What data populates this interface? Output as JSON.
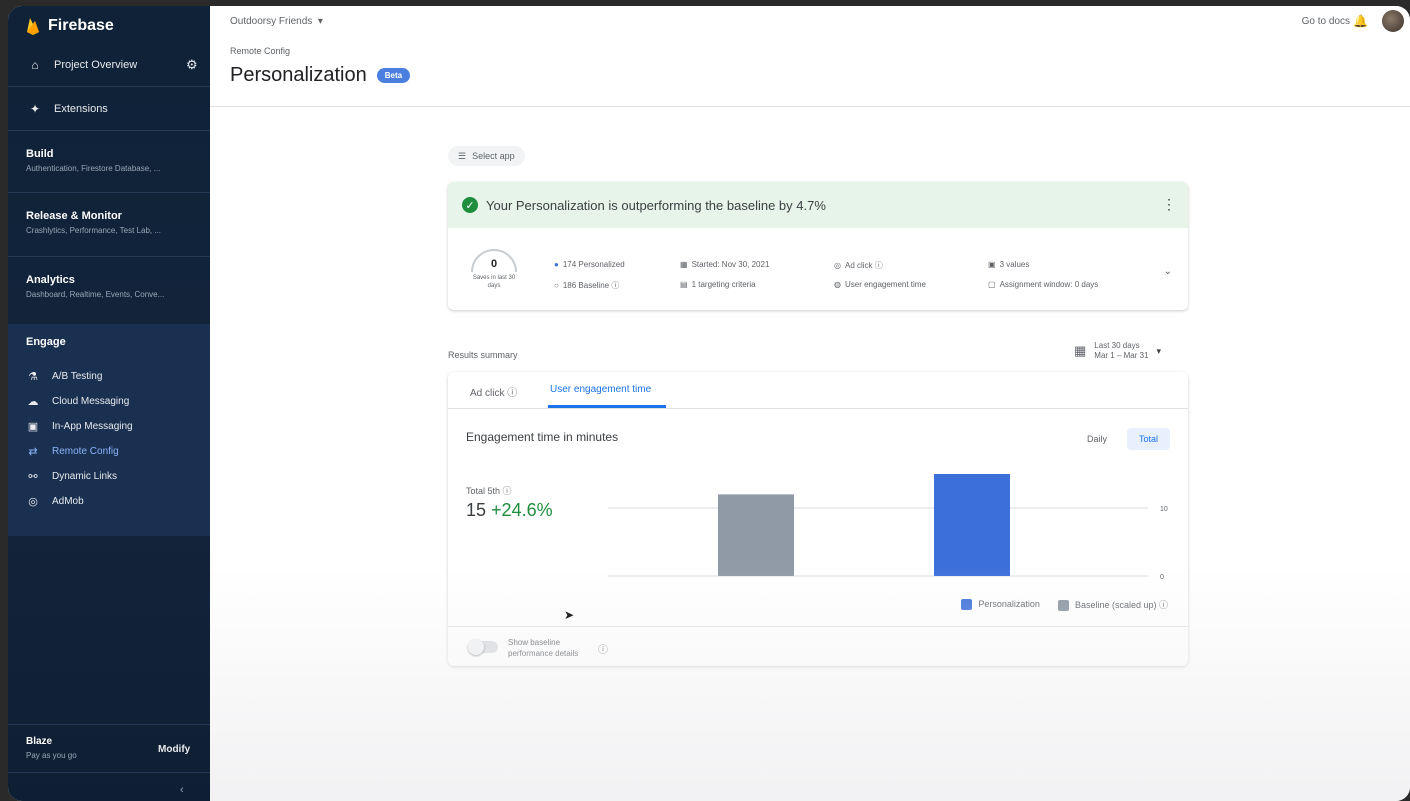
{
  "app": {
    "brand": "Firebase"
  },
  "sidebar": {
    "project_overview": "Project Overview",
    "extensions": "Extensions",
    "sections": [
      {
        "title": "Build",
        "subtitle": "Authentication, Firestore Database, ..."
      },
      {
        "title": "Release & Monitor",
        "subtitle": "Crashlytics, Performance, Test Lab, ..."
      },
      {
        "title": "Analytics",
        "subtitle": "Dashboard, Realtime, Events, Conve..."
      }
    ],
    "engage": {
      "title": "Engage",
      "items": [
        {
          "label": "A/B Testing",
          "icon": "flask-icon"
        },
        {
          "label": "Cloud Messaging",
          "icon": "cloud-messaging-icon"
        },
        {
          "label": "In-App Messaging",
          "icon": "in-app-messaging-icon"
        },
        {
          "label": "Remote Config",
          "icon": "remote-config-icon"
        },
        {
          "label": "Dynamic Links",
          "icon": "link-icon"
        },
        {
          "label": "AdMob",
          "icon": "admob-icon"
        }
      ],
      "active_index": 3
    },
    "plan": {
      "name": "Blaze",
      "sub": "Pay as you go",
      "modify": "Modify"
    }
  },
  "header": {
    "project": "Outdoorsy Friends",
    "breadcrumb": "Remote Config",
    "title": "Personalization",
    "badge": "Beta",
    "go_to_docs": "Go to docs"
  },
  "select_app": "Select app",
  "banner": {
    "message": "Your Personalization is outperforming the baseline by 4.7%"
  },
  "summary": {
    "gauge_value": "0",
    "gauge_label": "Saves in last 30 days",
    "meta": [
      "174 Personalized",
      "186 Baseline",
      "Started: Nov 30, 2021",
      "1 targeting criteria",
      "Ad click",
      "User engagement time",
      "3 values",
      "Assignment window: 0 days"
    ]
  },
  "results": {
    "label": "Results summary",
    "date_line1": "Last 30 days",
    "date_line2": "Mar 1 – Mar 31"
  },
  "chart_card": {
    "tabs": [
      "Ad click",
      "User engagement time"
    ],
    "active_tab": 1,
    "title": "Engagement time in minutes",
    "toggle": [
      "Daily",
      "Total"
    ],
    "total_label": "Total 5th",
    "total_value": "15",
    "total_change": "+24.6%",
    "show_baseline": "Show baseline performance details"
  },
  "chart_data": {
    "type": "bar",
    "categories": [
      "Baseline (scaled up)",
      "Personalization"
    ],
    "values": [
      12,
      15
    ],
    "colors": [
      "#909aa6",
      "#3d6fdb"
    ],
    "yticks": [
      0,
      10
    ],
    "ylim": [
      0,
      15
    ],
    "legend": [
      "Personalization",
      "Baseline (scaled up)"
    ],
    "legend_colors": [
      "#3d6fdb",
      "#8a94a0"
    ]
  }
}
